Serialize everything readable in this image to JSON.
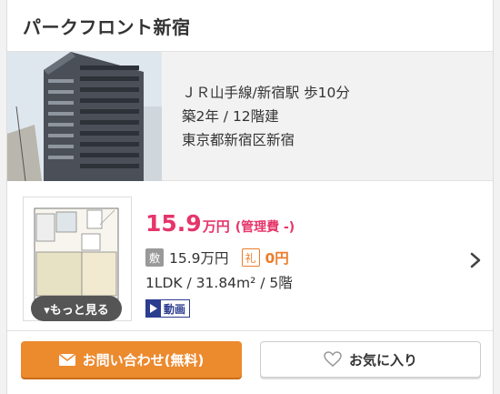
{
  "property": {
    "title": "パークフロント新宿",
    "access": "ＪＲ山手線/新宿駅 歩10分",
    "age_floors": "築2年 / 12階建",
    "address": "東京都新宿区新宿"
  },
  "listing": {
    "rent": "15.9",
    "rent_unit": "万円",
    "management_fee": "(管理費 -)",
    "deposit_tag": "敷",
    "deposit": "15.9万円",
    "key_money_tag": "礼",
    "key_money": "0円",
    "specs": "1LDK /  31.84m² /  5階",
    "more_label": "▾もっと見る",
    "video_label": "動画"
  },
  "actions": {
    "inquiry_label": "お問い合わせ(無料)",
    "favorite_label": "お気に入り"
  },
  "colors": {
    "rent": "#e6356a",
    "accent_orange": "#ec8a2e",
    "video_blue": "#2b3d8f"
  }
}
